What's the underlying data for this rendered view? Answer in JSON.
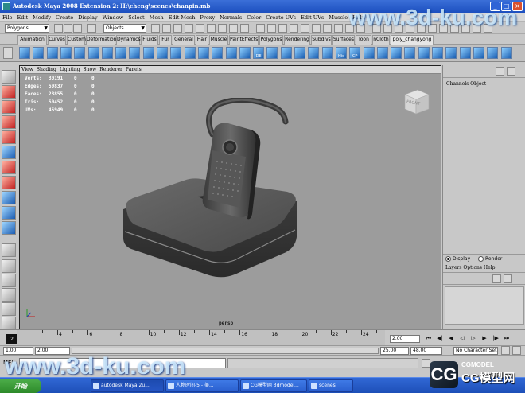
{
  "window": {
    "title": "Autodesk Maya 2008 Extension 2: H:\\cheng\\scenes\\chanpin.mb"
  },
  "menubar": [
    "File",
    "Edit",
    "Modify",
    "Create",
    "Display",
    "Window",
    "Select",
    "Mesh",
    "Edit Mesh",
    "Proxy",
    "Normals",
    "Color",
    "Create UVs",
    "Edit UVs",
    "Muscle",
    "Help"
  ],
  "statusline": {
    "menuset": "Polygons",
    "selection_mode": "Objects"
  },
  "shelf_tabs": [
    "Animation",
    "Curves",
    "Custom",
    "Deformation",
    "Dynamics",
    "Fluids",
    "Fur",
    "General",
    "Hair",
    "Muscle",
    "PaintEffects",
    "Polygons",
    "Rendering",
    "Subdivs",
    "Surfaces",
    "Toon",
    "nCloth",
    "poly_changyong"
  ],
  "shelf_icon_labels": {
    "de": "DE",
    "his": "His",
    "cp": "CP"
  },
  "viewport": {
    "panel_menus": [
      "View",
      "Shading",
      "Lighting",
      "Show",
      "Renderer",
      "Panels"
    ],
    "stats": [
      {
        "label": "Verts:",
        "value": "30191",
        "sel1": "0",
        "sel2": "0"
      },
      {
        "label": "Edges:",
        "value": "59837",
        "sel1": "0",
        "sel2": "0"
      },
      {
        "label": "Faces:",
        "value": "28855",
        "sel1": "0",
        "sel2": "0"
      },
      {
        "label": "Tris:",
        "value": "59452",
        "sel1": "0",
        "sel2": "0"
      },
      {
        "label": "UVs:",
        "value": "45949",
        "sel1": "0",
        "sel2": "0"
      }
    ],
    "view_cube_label": "FRONT",
    "camera": "persp"
  },
  "channel_box": {
    "header": "Channels  Object",
    "layer_tabs": [
      "Display",
      "Render"
    ],
    "layer_menus": "Layers  Options  Help"
  },
  "timeline": {
    "current_frame": "2",
    "ticks": [
      "4",
      "6",
      "8",
      "10",
      "12",
      "14",
      "16",
      "18",
      "20",
      "22",
      "24"
    ],
    "current_time_field": "2.00"
  },
  "range": {
    "start_time": "1.00",
    "playback_start": "2.00",
    "playback_end": "25.00",
    "end_time": "48.00",
    "character_set": "No Character Set"
  },
  "cmdline": {
    "label": "MEL"
  },
  "taskbar": {
    "start_label": "开始",
    "items": [
      "autodesk Maya 2u...",
      "人物时间-5 - 美...",
      "CG模型网 3dmodel...",
      "scenes"
    ]
  },
  "watermarks": {
    "top": "www.3d-ku.com",
    "bottom": "www.3d-ku.com",
    "logo_main": "CG模型网",
    "logo_sub": "CGMODEL"
  },
  "colors": {
    "viewport_bg": "#9c9c9c",
    "title_bar": "#1c4fbf",
    "taskbar": "#2656c4",
    "start_button": "#2d8a2a"
  }
}
